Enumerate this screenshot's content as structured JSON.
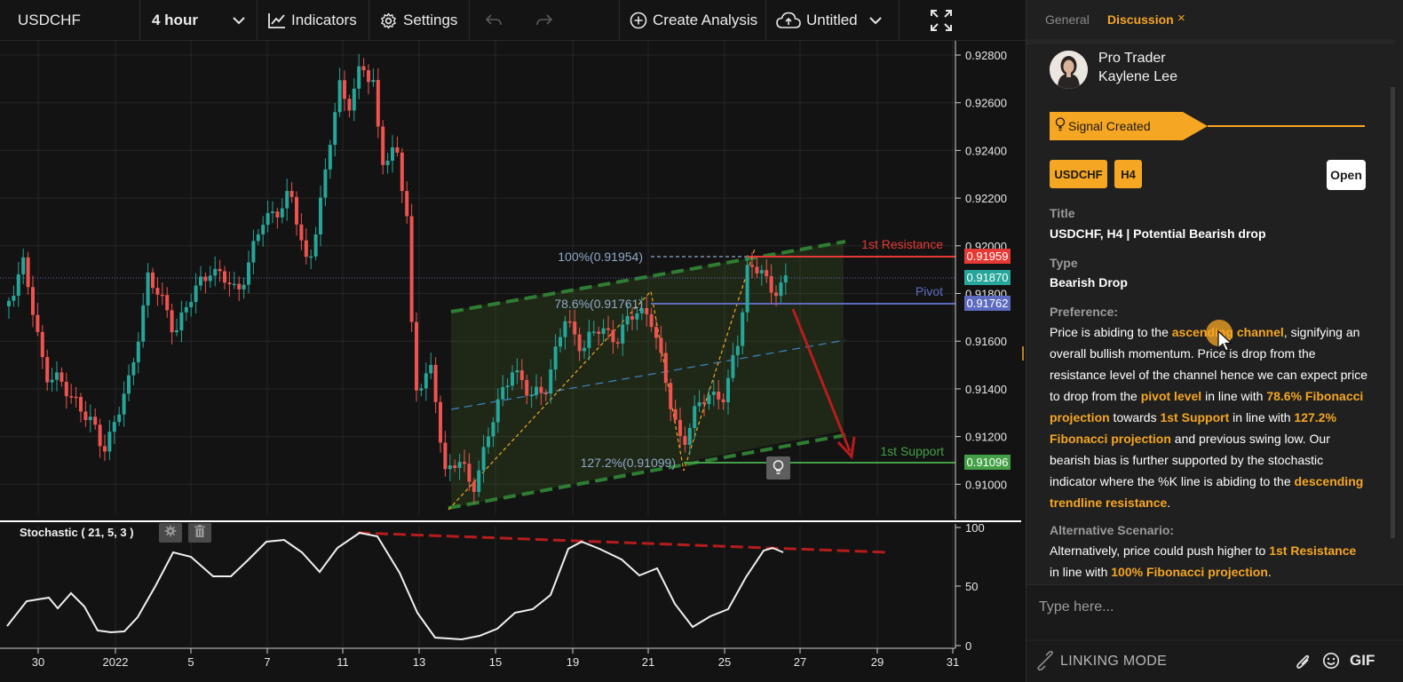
{
  "toolbar": {
    "symbol": "USDCHF",
    "timeframe": "4 hour",
    "indicators_label": "Indicators",
    "settings_label": "Settings",
    "create_analysis_label": "Create Analysis",
    "document_name": "Untitled"
  },
  "chart": {
    "price_axis_labels": [
      "0.92800",
      "0.92600",
      "0.92400",
      "0.92200",
      "0.92000",
      "0.91800",
      "0.91600",
      "0.91400",
      "0.91200",
      "0.91000"
    ],
    "date_axis_labels": [
      "30",
      "2022",
      "5",
      "7",
      "11",
      "13",
      "15",
      "19",
      "21",
      "25",
      "27",
      "29",
      "31"
    ],
    "price_tags": {
      "resistance": "0.91959",
      "current": "0.91870",
      "pivot": "0.91762",
      "support": "0.91096"
    },
    "annotations": {
      "resistance_label": "1st Resistance",
      "pivot_label": "Pivot",
      "support_label": "1st Support",
      "fib_100": "100%(0.91954)",
      "fib_786": "78.6%(0.91761)",
      "fib_1272": "127.2%(0.91099)"
    },
    "colors": {
      "bull": "#26a69a",
      "bear": "#ef5350",
      "resistance": "#e53935",
      "support": "#43a047",
      "pivot": "#5c6bc0",
      "channel": "#2e7d32",
      "accent": "#f5a623"
    }
  },
  "stochastic": {
    "title": "Stochastic ( 21, 5, 3 )",
    "axis_labels": [
      "100",
      "50",
      "0"
    ]
  },
  "panel": {
    "tabs": {
      "general": "General",
      "discussion": "Discussion",
      "close": "×"
    },
    "author": {
      "role": "Pro Trader",
      "name": "Kaylene Lee"
    },
    "signal_label": "Signal Created",
    "tags": [
      "USDCHF",
      "H4"
    ],
    "open_label": "Open",
    "title_label": "Title",
    "title_value": "USDCHF, H4 | Potential Bearish drop",
    "type_label": "Type",
    "type_value": "Bearish Drop",
    "preference_label": "Preference:",
    "preference": {
      "t1": "Price is abiding to the ",
      "h1": "ascending channel",
      "t2": ", signifying an overall bullish momentum. Price is drop from the resistance level of the channel hence we can expect price to drop from the ",
      "h2": "pivot level",
      "t3": " in line with ",
      "h3": "78.6% Fibonacci projection",
      "t4": " towards ",
      "h4": "1st Support",
      "t5": " in line with ",
      "h5": "127.2% Fibonacci projection",
      "t6": " and previous swing low. Our bearish bias is further supported by the stochastic indicator where the %K line is abiding to the ",
      "h6": "descending trendline resistance",
      "t7": "."
    },
    "alternative_label": "Alternative Scenario:",
    "alternative": {
      "t1": "Alternatively, price could push higher to ",
      "h1": "1st Resistance",
      "t2": " in line with ",
      "h2": "100% Fibonacci projection",
      "t3": "."
    },
    "input_placeholder": "Type here...",
    "linking_mode": "LINKING MODE",
    "gif_label": "GIF"
  }
}
